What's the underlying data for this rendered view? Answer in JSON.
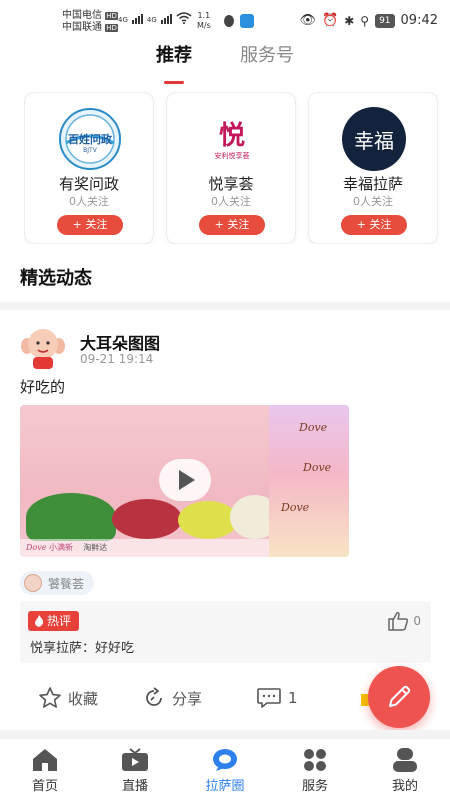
{
  "status_bar": {
    "carrier1": "中国电信",
    "carrier2": "中国联通",
    "hd": "HD",
    "net_type": "4G",
    "speed_value": "1.1",
    "speed_unit": "M/s",
    "battery": "91",
    "time": "09:42"
  },
  "top_tabs": [
    {
      "label": "推荐",
      "active": true
    },
    {
      "label": "服务号",
      "active": false
    }
  ],
  "accounts": [
    {
      "name": "有奖问政",
      "followers": "0人关注",
      "follow_label": "+ 关注",
      "logo_text": "百姓问政",
      "logo_sub": "BJTV"
    },
    {
      "name": "悦享荟",
      "followers": "0人关注",
      "follow_label": "+ 关注",
      "logo_text": "悦",
      "logo_sub": "安利悦享荟"
    },
    {
      "name": "幸福拉萨",
      "followers": "0人关注",
      "follow_label": "+ 关注",
      "logo_text": "幸福"
    }
  ],
  "section_title": "精选动态",
  "post": {
    "author": "大耳朵图图",
    "time": "09-21 19:14",
    "text": "好吃的",
    "video_brand": "Dove",
    "video_brand_sub": "小满新",
    "video_partner": "淘鲜达",
    "tag": "饕餮荟",
    "hot_comment_label": "热评",
    "comment_author": "悦享拉萨",
    "comment_text": "悦享拉萨：好好吃",
    "like_count": "0",
    "actions": {
      "favorite": "收藏",
      "share": "分享",
      "comment_count": "1"
    }
  },
  "bottom_nav": [
    {
      "label": "首页",
      "icon": "home-icon",
      "active": false
    },
    {
      "label": "直播",
      "icon": "tv-icon",
      "active": false
    },
    {
      "label": "拉萨圈",
      "icon": "chat-bubble-icon",
      "active": true
    },
    {
      "label": "服务",
      "icon": "grid-icon",
      "active": false
    },
    {
      "label": "我的",
      "icon": "person-icon",
      "active": false
    }
  ],
  "colors": {
    "accent_red": "#e84c3d",
    "active_blue": "#2f80ed",
    "fab": "#ef5350"
  }
}
